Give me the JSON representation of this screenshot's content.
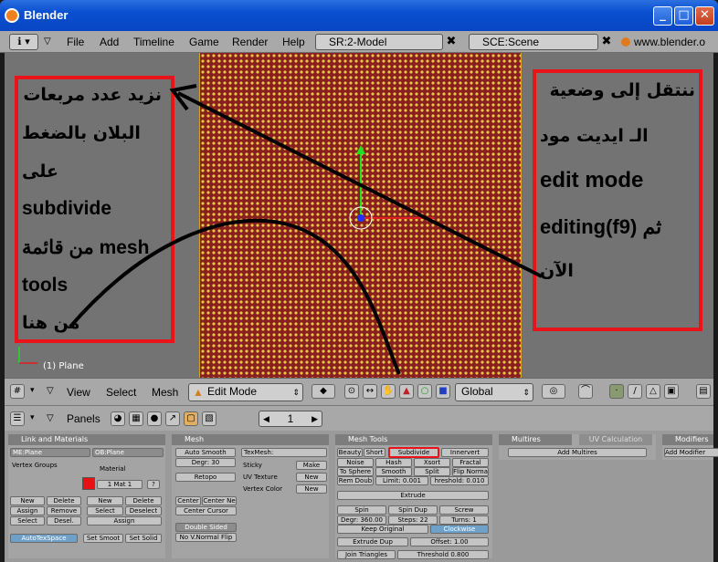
{
  "app": {
    "title": "Blender"
  },
  "window": {
    "minimize": "_",
    "maximize": "□",
    "close": "✕"
  },
  "topbar": {
    "menus": [
      "File",
      "Add",
      "Timeline",
      "Game",
      "Render",
      "Help"
    ],
    "screen": "SR:2-Model",
    "scene": "SCE:Scene",
    "url": "www.blender.o"
  },
  "viewport": {
    "object_label": "(1) Plane",
    "left_callout": [
      "نزيد عدد مربعات",
      "البلان بالضغط",
      "على",
      "subdivide",
      "من قائمة mesh",
      "tools",
      "من هنا"
    ],
    "right_callout": [
      "ننتقل إلى وضعية",
      "الـ ايديت مود",
      "edit mode",
      "ثم  editing(f9)",
      "الآن"
    ]
  },
  "view3d_header": {
    "menus": [
      "View",
      "Select",
      "Mesh"
    ],
    "mode": "Edit Mode",
    "orientation": "Global"
  },
  "buttons_header": {
    "label": "Panels",
    "frame": "1"
  },
  "panels": {
    "link": {
      "title": "Link and Materials",
      "me": "ME:Plane",
      "ob": "OB:Plane",
      "vg": "Vertex Groups",
      "material": "Material",
      "mat": "1 Mat 1",
      "q": "?",
      "buttons": [
        "New",
        "Delete",
        "Assign",
        "Remove",
        "Select",
        "Desel.",
        "New",
        "Delete",
        "Select",
        "Deselect",
        "Assign"
      ],
      "autotex": "AutoTexSpace",
      "setsmooth": "Set Smoot",
      "setsolid": "Set Solid"
    },
    "mesh": {
      "title": "Mesh",
      "autosmooth": "Auto Smooth",
      "degr": "Degr: 30",
      "retopo": "Retopo",
      "texmesh": "TexMesh:",
      "sticky": "Sticky",
      "uvtex": "UV Texture",
      "vcol": "Vertex Color",
      "make": "Make",
      "new1": "New",
      "new2": "New",
      "cn": "Center",
      "cnew": "Center Ne",
      "ccur": "Center Cursor",
      "ds": "Double Sided",
      "nonorm": "No V.Normal Flip"
    },
    "meshtools": {
      "title": "Mesh Tools",
      "row1": [
        "Beauty",
        "Short",
        "Subdivide",
        "Innervert"
      ],
      "row2": [
        "Noise",
        "Hash",
        "Xsort",
        "Fractal"
      ],
      "row3": [
        "To Sphere",
        "Smooth",
        "Split",
        "Flip Norma"
      ],
      "row4": [
        "Rem Doub",
        "Limit: 0.001",
        "hreshold: 0.010"
      ],
      "extrude": "Extrude",
      "row5": [
        "Spin",
        "Spin Dup",
        "Screw"
      ],
      "row6": [
        "Degr: 360.00",
        "Steps: 22",
        "Turns: 1"
      ],
      "keep": "Keep Original",
      "cw": "Clockwise",
      "extdup": "Extrude Dup",
      "offset": "Offset: 1.00",
      "join": "Join Triangles",
      "thresh": "Threshold 0.800"
    },
    "multires": {
      "title": "Multires",
      "uvcalc": "UV Calculation",
      "add": "Add Multires"
    },
    "modifiers": {
      "title": "Modifiers",
      "add": "Add Modifier"
    }
  },
  "colors": {
    "accent": "#e8141a",
    "mesh_face": "#8a1f1f",
    "mesh_vertex": "#e8c84a"
  }
}
